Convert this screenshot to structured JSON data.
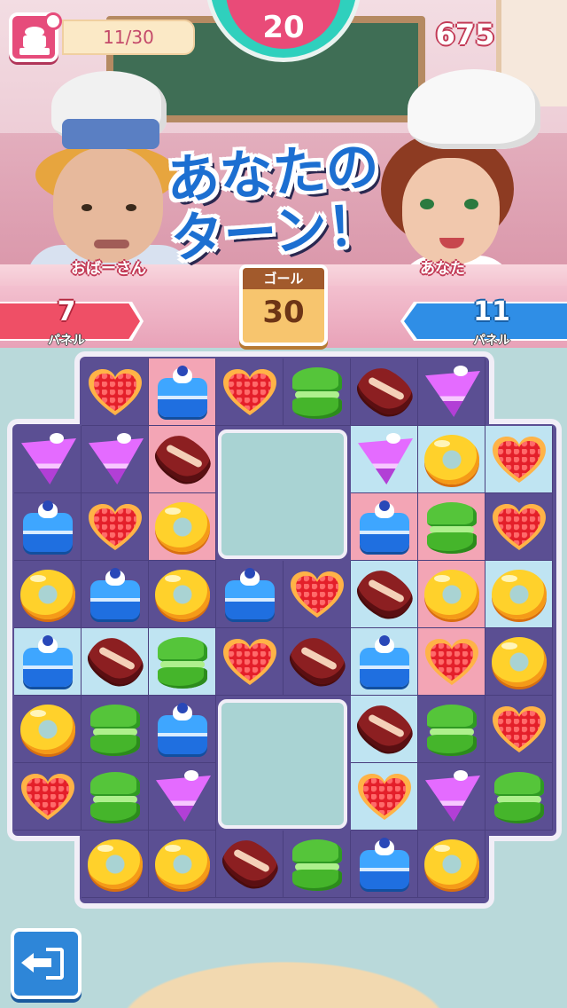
{
  "hud": {
    "moves": "11/30",
    "timer": "20",
    "score": "675"
  },
  "characters": {
    "opponent_name": "おばーさん",
    "you_name": "あなた"
  },
  "banner": {
    "line1": "あなたの",
    "line2": "ターン！"
  },
  "score_bars": {
    "opponent": {
      "count": "7",
      "label": "パネル",
      "color": "#ef4f66"
    },
    "you": {
      "count": "11",
      "label": "パネル",
      "color": "#2f8ee6"
    }
  },
  "goal": {
    "label": "ゴール",
    "value": "30"
  },
  "board": {
    "rows": 8,
    "cols": 8,
    "cells": [
      [
        null,
        "heart",
        "cake",
        "heart",
        "macaron",
        "peanut",
        "slice",
        null
      ],
      [
        "slice",
        "slice",
        "peanut",
        "hole",
        "hole",
        "slice",
        "donut",
        "heart"
      ],
      [
        "cake",
        "heart",
        "donut",
        "hole",
        "hole",
        "cake",
        "macaron",
        "heart"
      ],
      [
        "donut",
        "cake",
        "donut",
        "cake",
        "heart",
        "peanut",
        "donut",
        "donut"
      ],
      [
        "cake",
        "peanut",
        "macaron",
        "heart",
        "peanut",
        "cake",
        "heart",
        "donut"
      ],
      [
        "donut",
        "macaron",
        "cake",
        "hole",
        "hole",
        "peanut",
        "macaron",
        "heart"
      ],
      [
        "heart",
        "macaron",
        "slice",
        "hole",
        "hole",
        "heart",
        "slice",
        "macaron"
      ],
      [
        null,
        "donut",
        "donut",
        "peanut",
        "macaron",
        "cake",
        "donut",
        null
      ]
    ],
    "highlights": [
      [
        null,
        "none",
        "pink",
        "none",
        "none",
        "none",
        "none",
        null
      ],
      [
        "none",
        "none",
        "pink",
        null,
        null,
        "blue",
        "blue",
        "blue"
      ],
      [
        "none",
        "none",
        "pink",
        null,
        null,
        "pink",
        "pink",
        "none"
      ],
      [
        "none",
        "none",
        "none",
        "none",
        "none",
        "blue",
        "pink",
        "blue"
      ],
      [
        "blue",
        "blue",
        "blue",
        "none",
        "none",
        "blue",
        "pink",
        "none"
      ],
      [
        "none",
        "none",
        "none",
        null,
        null,
        "blue",
        "none",
        "none"
      ],
      [
        "none",
        "none",
        "none",
        null,
        null,
        "blue",
        "none",
        "none"
      ],
      [
        null,
        "none",
        "none",
        "none",
        "none",
        "none",
        "none",
        null
      ]
    ],
    "piece_types": [
      "donut",
      "heart",
      "cake",
      "macaron",
      "peanut",
      "slice"
    ]
  },
  "icons": {
    "menu": "cake-clock-icon",
    "exit": "exit-door-icon"
  }
}
